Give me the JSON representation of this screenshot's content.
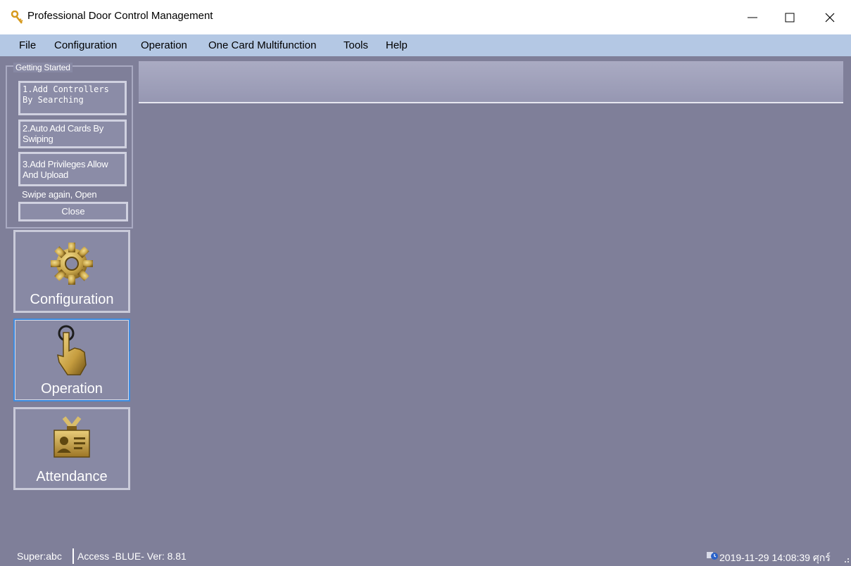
{
  "window": {
    "title": "Professional Door Control Management",
    "icon": "key-icon"
  },
  "menu": {
    "items": [
      {
        "label": "File"
      },
      {
        "label": "Configuration"
      },
      {
        "label": "Operation"
      },
      {
        "label": "One Card Multifunction"
      },
      {
        "label": "Tools"
      },
      {
        "label": "Help"
      }
    ]
  },
  "getting_started": {
    "legend": "Getting Started",
    "step1": "1.Add Controllers By Searching",
    "step2": "2.Auto Add Cards By Swiping",
    "step3": "3.Add Privileges Allow And Upload",
    "hint": "Swipe again, Open",
    "close_label": "Close"
  },
  "nav": {
    "configuration": {
      "label": "Configuration",
      "icon": "gear-icon"
    },
    "operation": {
      "label": "Operation",
      "icon": "hand-pointer-icon"
    },
    "attendance": {
      "label": "Attendance",
      "icon": "id-card-icon"
    }
  },
  "status": {
    "user": "Super:abc",
    "access": "Access -BLUE- Ver: 8.81",
    "datetime": "2019-11-29 14:08:39 ศุกร์"
  },
  "colors": {
    "background": "#7f7f99",
    "menubar": "#b4c8e4",
    "active_border": "#3c8be0",
    "gold": "#c9a64a"
  }
}
